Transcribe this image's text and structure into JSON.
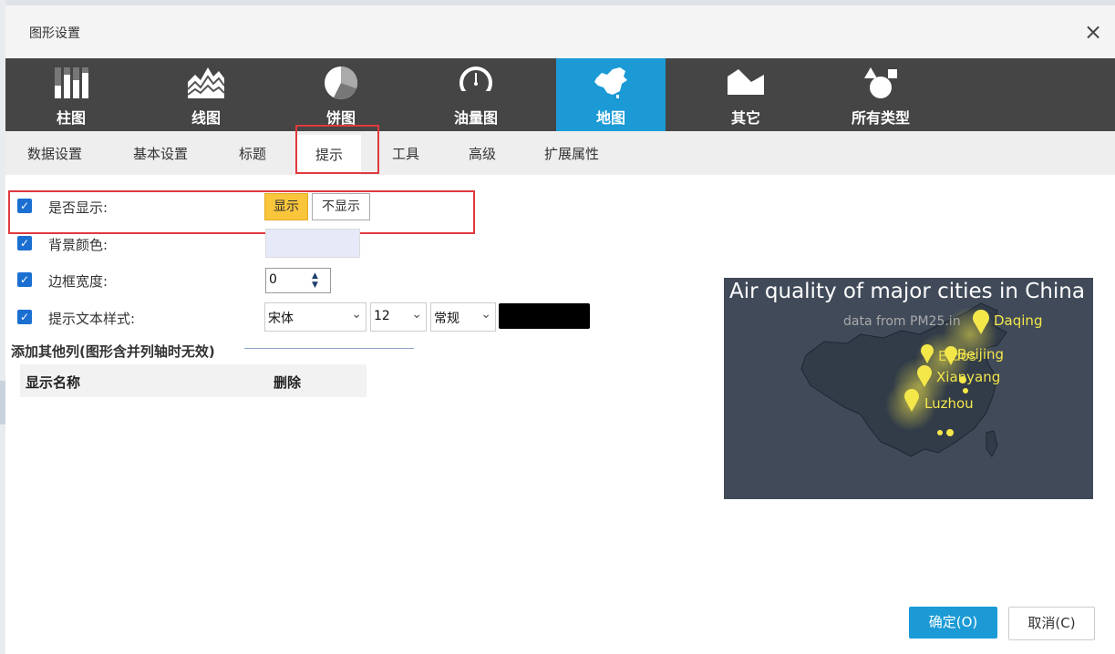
{
  "dialog": {
    "title": "图形设置"
  },
  "chart_types": [
    {
      "label": "柱图",
      "icon": "bar-chart-icon"
    },
    {
      "label": "线图",
      "icon": "line-chart-icon"
    },
    {
      "label": "饼图",
      "icon": "pie-chart-icon"
    },
    {
      "label": "油量图",
      "icon": "gauge-icon"
    },
    {
      "label": "地图",
      "icon": "china-map-icon",
      "active": true
    },
    {
      "label": "其它",
      "icon": "other-shape-icon"
    },
    {
      "label": "所有类型",
      "icon": "all-types-icon"
    }
  ],
  "sub_tabs": [
    {
      "label": "数据设置"
    },
    {
      "label": "基本设置"
    },
    {
      "label": "标题"
    },
    {
      "label": "提示",
      "active": true
    },
    {
      "label": "工具"
    },
    {
      "label": "高级"
    },
    {
      "label": "扩展属性"
    }
  ],
  "settings": {
    "show": {
      "label": "是否显示:",
      "on_label": "显示",
      "off_label": "不显示",
      "checked": true,
      "value": "显示"
    },
    "bg_color": {
      "label": "背景颜色:",
      "checked": true,
      "color": "#e6e9f8"
    },
    "border_width": {
      "label": "边框宽度:",
      "checked": true,
      "value": "0"
    },
    "text_style": {
      "label": "提示文本样式:",
      "checked": true,
      "font": "宋体",
      "size": "12",
      "weight": "常规",
      "color": "#000000"
    }
  },
  "extra_columns": {
    "title": "添加其他列(图形含并列轴时无效)",
    "headers": [
      "显示名称",
      "删除"
    ]
  },
  "preview": {
    "title": "Air quality of major cities in China",
    "subtitle": "data from PM25.in",
    "labels": [
      "Daqing",
      "Beijing",
      "Erdos",
      "Xianyang",
      "Luzhou"
    ]
  },
  "footer": {
    "ok": "确定(O)",
    "cancel": "取消(C)"
  },
  "colors": {
    "accent": "#1b9ad6",
    "highlight": "#f9c53b",
    "annotation": "#e0393e",
    "map_bg": "#404a59"
  }
}
